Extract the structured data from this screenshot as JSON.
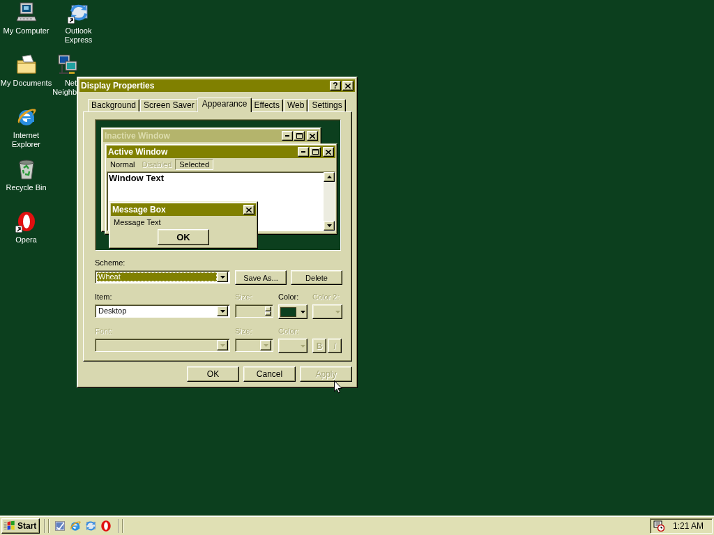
{
  "desktop": {
    "icons": [
      {
        "label": "My Computer",
        "kind": "computer",
        "shortcut": false,
        "covered": false
      },
      {
        "label": "Outlook Express",
        "kind": "mail",
        "shortcut": true,
        "covered": false
      },
      {
        "label": "My Documents",
        "kind": "folder",
        "shortcut": false,
        "covered": false
      },
      {
        "label": "Net\nNeighb",
        "kind": "network",
        "shortcut": false,
        "covered": true
      },
      {
        "label": "Internet Explorer",
        "kind": "browser",
        "shortcut": false,
        "covered": false
      },
      {
        "label": "Recycle Bin",
        "kind": "bin",
        "shortcut": false,
        "covered": false
      },
      {
        "label": "Opera",
        "kind": "opera",
        "shortcut": true,
        "covered": false
      }
    ]
  },
  "dialog": {
    "title": "Display Properties",
    "help_button": "?",
    "tabs": [
      {
        "label": "Background",
        "selected": false
      },
      {
        "label": "Screen Saver",
        "selected": false
      },
      {
        "label": "Appearance",
        "selected": true
      },
      {
        "label": "Effects",
        "selected": false
      },
      {
        "label": "Web",
        "selected": false
      },
      {
        "label": "Settings",
        "selected": false
      }
    ],
    "preview": {
      "inactive_window": {
        "title": "Inactive Window"
      },
      "active_window": {
        "title": "Active Window",
        "menu": [
          {
            "label": "Normal",
            "disabled": false,
            "selected": false
          },
          {
            "label": "Disabled",
            "disabled": true,
            "selected": false
          },
          {
            "label": "Selected",
            "disabled": false,
            "selected": true
          }
        ],
        "window_text": "Window Text"
      },
      "message_box": {
        "title": "Message Box",
        "text": "Message Text",
        "button": "OK"
      }
    },
    "scheme": {
      "label": "Scheme:",
      "value": "Wheat",
      "buttons": [
        {
          "label": "Save As...",
          "disabled": false
        },
        {
          "label": "Delete",
          "disabled": false
        }
      ]
    },
    "item_row": {
      "item": {
        "label": "Item:",
        "value": "Desktop"
      },
      "size": {
        "label": "Size:",
        "disabled": true
      },
      "color": {
        "label": "Color:",
        "disabled": false,
        "color": "#0c3f1e"
      },
      "color_2": {
        "label": "Color 2:",
        "disabled": true
      }
    },
    "font_row": {
      "font": {
        "label": "Font:",
        "disabled": true
      },
      "size": {
        "label": "Size:",
        "disabled": true
      },
      "color": {
        "label": "Color:",
        "disabled": true
      },
      "bold_button": {
        "label": "B",
        "disabled": true
      },
      "italic_button": {
        "label": "I",
        "disabled": true
      }
    },
    "buttons": [
      {
        "label": "OK",
        "disabled": false
      },
      {
        "label": "Cancel",
        "disabled": false
      },
      {
        "label": "Apply",
        "disabled": true
      }
    ]
  },
  "taskbar": {
    "start": "Start",
    "quick_launch": [
      {
        "kind": "desktop"
      },
      {
        "kind": "browser"
      },
      {
        "kind": "mail"
      },
      {
        "kind": "opera"
      }
    ],
    "clock": "1:21 AM"
  }
}
